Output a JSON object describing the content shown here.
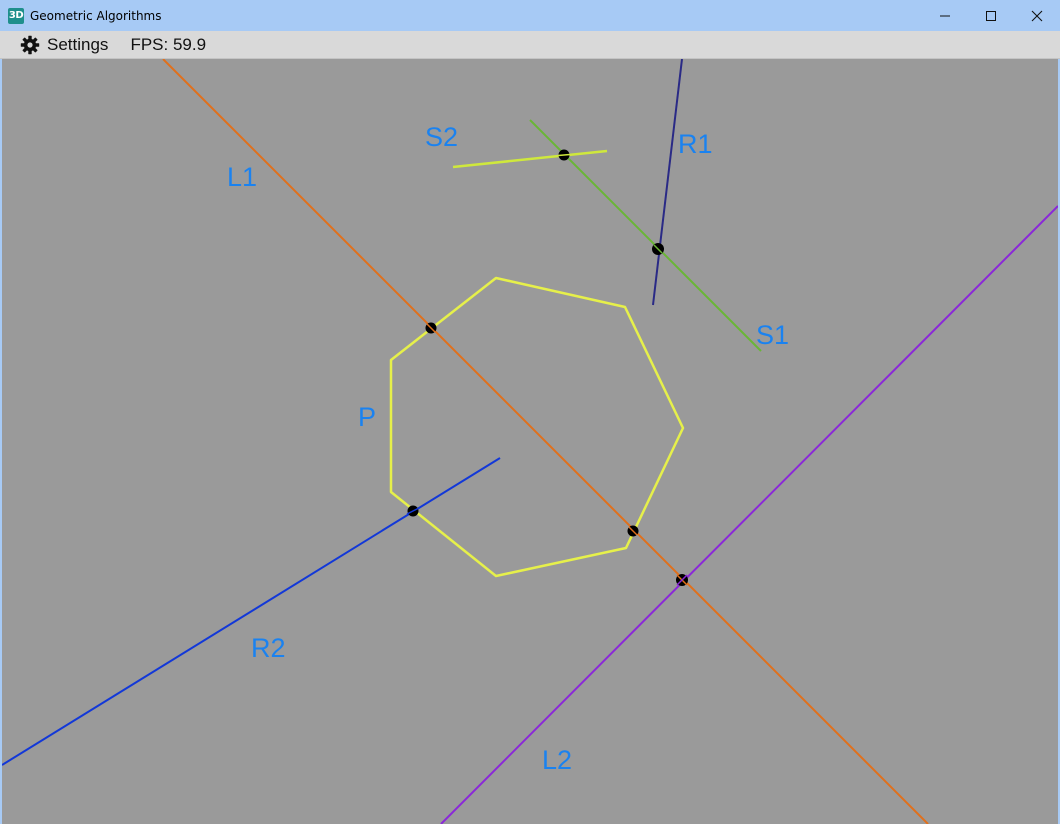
{
  "window": {
    "title": "Geometric Algorithms",
    "icon_text": "3D",
    "controls": [
      "minimize-icon",
      "maximize-icon",
      "close-icon"
    ]
  },
  "menubar": {
    "settings_label": "Settings",
    "fps_label": "FPS: 59.9"
  },
  "scene": {
    "background": "#9a9a9a",
    "label_color": "#1a82f0",
    "labels": {
      "L1": "L1",
      "L2": "L2",
      "R1": "R1",
      "R2": "R2",
      "S1": "S1",
      "S2": "S2",
      "P": "P"
    },
    "colors": {
      "L1": "#e0701c",
      "L2": "#8a28d8",
      "R1": "#2a2a86",
      "R2": "#1238d8",
      "S1": "#6ab636",
      "S2": "#cfe83c",
      "P": "#e6f04a",
      "intersection": "#000000"
    }
  }
}
